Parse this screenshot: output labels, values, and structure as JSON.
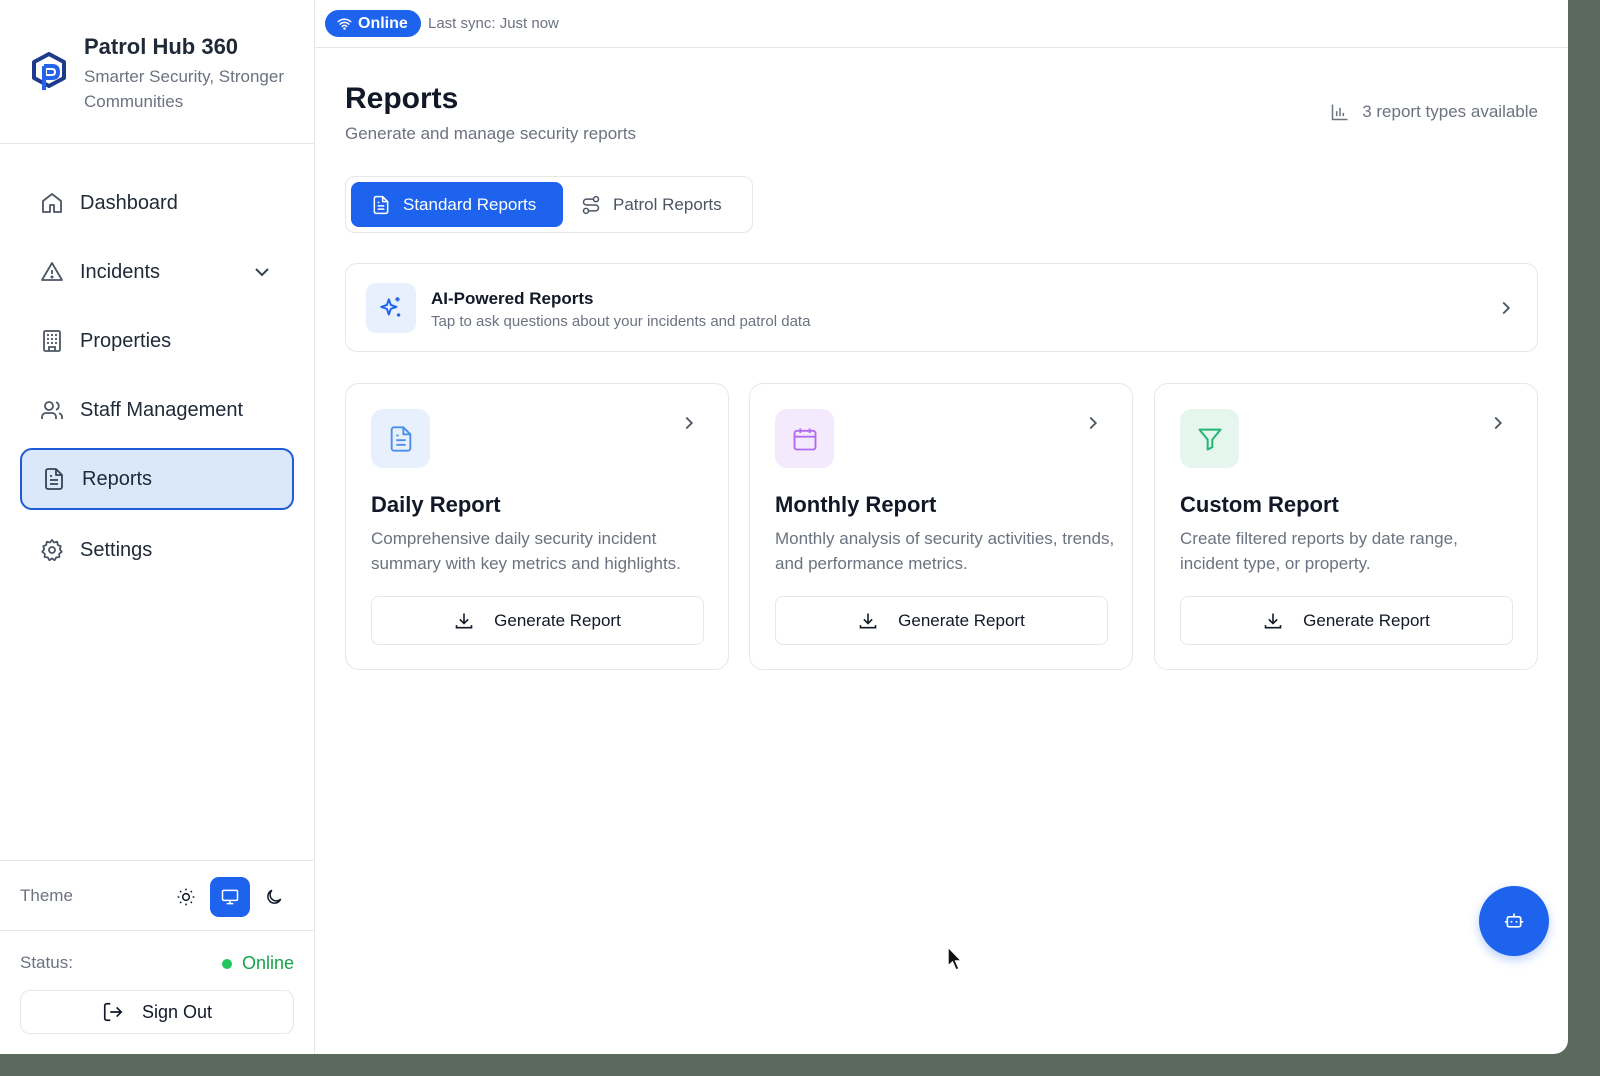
{
  "brand": {
    "title": "Patrol Hub 360",
    "subtitle": "Smarter Security, Stronger Communities"
  },
  "sidebar": {
    "items": [
      {
        "label": "Dashboard",
        "icon": "home-icon"
      },
      {
        "label": "Incidents",
        "icon": "alert-triangle-icon",
        "expandable": true
      },
      {
        "label": "Properties",
        "icon": "building-icon"
      },
      {
        "label": "Staff Management",
        "icon": "users-icon"
      },
      {
        "label": "Reports",
        "icon": "file-text-icon",
        "active": true
      },
      {
        "label": "Settings",
        "icon": "gear-icon"
      }
    ],
    "theme_label": "Theme",
    "theme_selected": "system",
    "status_label": "Status:",
    "status_value": "Online",
    "signout_label": "Sign Out"
  },
  "topbar": {
    "online_label": "Online",
    "last_sync": "Last sync: Just now"
  },
  "main": {
    "title": "Reports",
    "subtitle": "Generate and manage security reports",
    "types_available": "3 report types available",
    "tabs": [
      {
        "label": "Standard Reports",
        "active": true
      },
      {
        "label": "Patrol Reports",
        "active": false
      }
    ],
    "ai_card": {
      "title": "AI-Powered Reports",
      "subtitle": "Tap to ask questions about your incidents and patrol data"
    },
    "report_cards": [
      {
        "title": "Daily Report",
        "description": "Comprehensive daily security incident summary with key metrics and highlights.",
        "button": "Generate Report",
        "icon": "file-text-icon",
        "accent": "#4a8ef0"
      },
      {
        "title": "Monthly Report",
        "description": "Monthly analysis of security activities, trends, and performance metrics.",
        "button": "Generate Report",
        "icon": "calendar-icon",
        "accent": "#b06cf0"
      },
      {
        "title": "Custom Report",
        "description": "Create filtered reports by date range, incident type, or property.",
        "button": "Generate Report",
        "icon": "filter-icon",
        "accent": "#22b573"
      }
    ]
  },
  "colors": {
    "primary": "#1d63ed",
    "active_nav_bg": "#dbe7fb",
    "online_green": "#16a34a"
  }
}
